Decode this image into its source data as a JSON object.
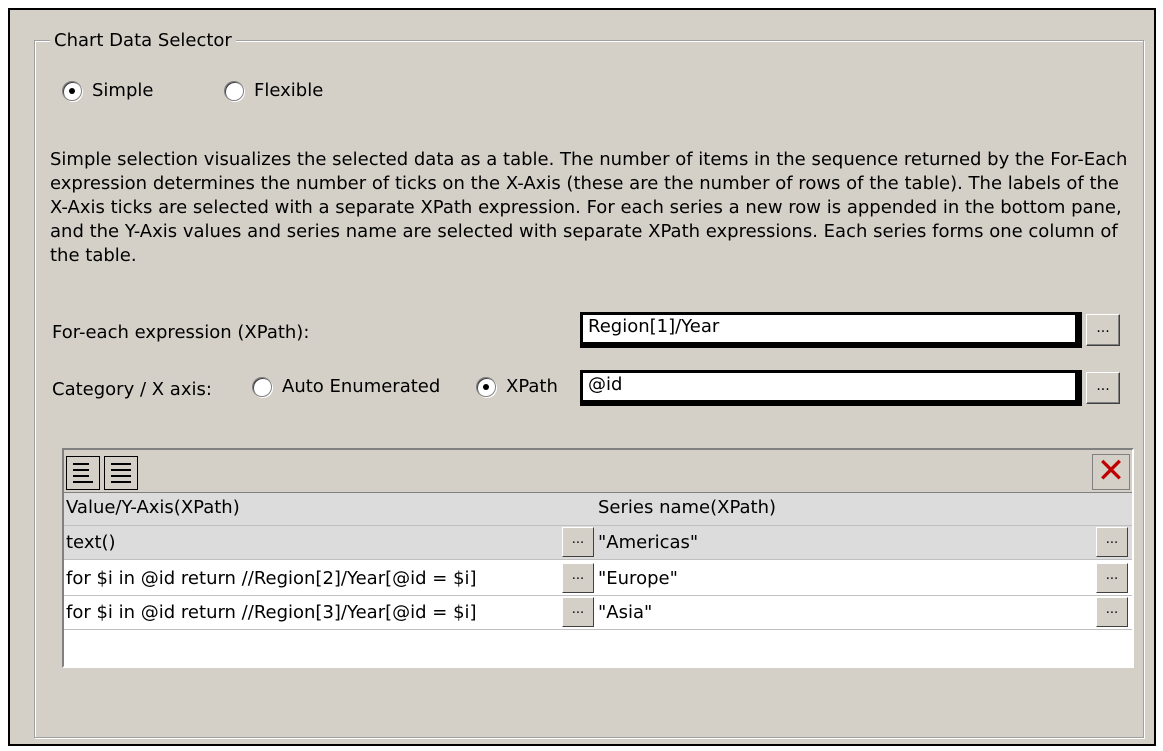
{
  "group_title": "Chart Data Selector",
  "mode": {
    "simple_label": "Simple",
    "flexible_label": "Flexible",
    "selected": "simple"
  },
  "description": "Simple selection visualizes the selected data as a table. The number of items in the sequence returned by the For-Each expression determines the number of ticks on the X-Axis (these are the number of rows of the table). The labels of the X-Axis ticks are selected with a separate XPath expression. For each series a new row is appended in the bottom pane, and the Y-Axis values and series name are selected with separate XPath expressions. Each series forms one column of the table.",
  "for_each": {
    "label": "For-each expression (XPath):",
    "value": "Region[1]/Year",
    "browse_label": "..."
  },
  "category": {
    "label": "Category / X axis:",
    "auto_label": "Auto Enumerated",
    "xpath_label": "XPath",
    "selected": "xpath",
    "value": "@id",
    "browse_label": "..."
  },
  "table": {
    "columns": [
      "Value/Y-Axis(XPath)",
      "Series name(XPath)"
    ],
    "rows": [
      {
        "value": "text()",
        "series": "\"Americas\""
      },
      {
        "value": "for $i in @id return //Region[2]/Year[@id = $i]",
        "series": "\"Europe\""
      },
      {
        "value": "for $i in @id return //Region[3]/Year[@id = $i]",
        "series": "\"Asia\""
      }
    ],
    "browse_label": "...",
    "delete_icon": "x-icon"
  }
}
